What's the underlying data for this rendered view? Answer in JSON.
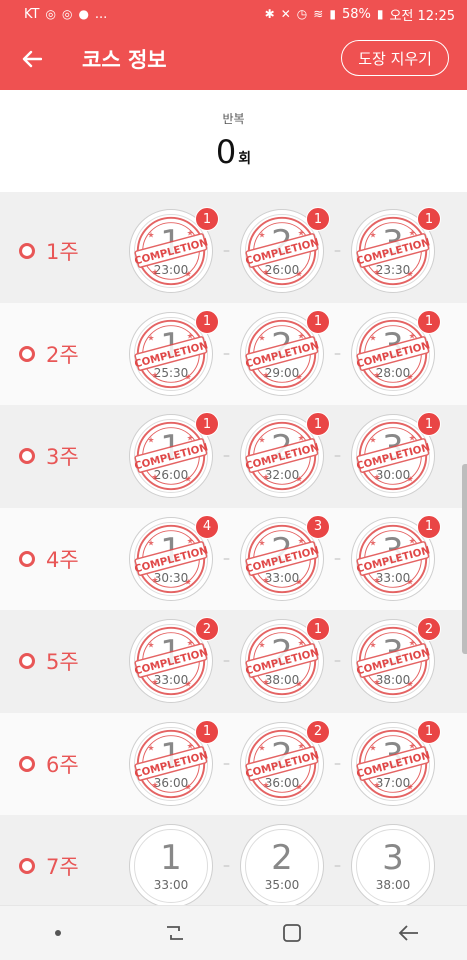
{
  "status_bar": {
    "carrier": "KT",
    "left_icons": [
      "instagram-icon",
      "instagram-icon",
      "talk-icon"
    ],
    "more": "...",
    "battery": "58%",
    "time_label": "오전 12:25"
  },
  "app_bar": {
    "title": "코스 정보",
    "clear_button": "도장 지우기"
  },
  "repeat": {
    "label": "반복",
    "value": "0",
    "unit": "회"
  },
  "weeks": [
    {
      "label": "1주",
      "sessions": [
        {
          "num": "1",
          "time": "23:00",
          "count": "1",
          "completed": true
        },
        {
          "num": "2",
          "time": "26:00",
          "count": "1",
          "completed": true
        },
        {
          "num": "3",
          "time": "23:30",
          "count": "1",
          "completed": true
        }
      ]
    },
    {
      "label": "2주",
      "sessions": [
        {
          "num": "1",
          "time": "25:30",
          "count": "1",
          "completed": true
        },
        {
          "num": "2",
          "time": "29:00",
          "count": "1",
          "completed": true
        },
        {
          "num": "3",
          "time": "28:00",
          "count": "1",
          "completed": true
        }
      ]
    },
    {
      "label": "3주",
      "sessions": [
        {
          "num": "1",
          "time": "26:00",
          "count": "1",
          "completed": true
        },
        {
          "num": "2",
          "time": "32:00",
          "count": "1",
          "completed": true
        },
        {
          "num": "3",
          "time": "30:00",
          "count": "1",
          "completed": true
        }
      ]
    },
    {
      "label": "4주",
      "sessions": [
        {
          "num": "1",
          "time": "30:30",
          "count": "4",
          "completed": true
        },
        {
          "num": "2",
          "time": "33:00",
          "count": "3",
          "completed": true
        },
        {
          "num": "3",
          "time": "33:00",
          "count": "1",
          "completed": true
        }
      ]
    },
    {
      "label": "5주",
      "sessions": [
        {
          "num": "1",
          "time": "33:00",
          "count": "2",
          "completed": true
        },
        {
          "num": "2",
          "time": "38:00",
          "count": "1",
          "completed": true
        },
        {
          "num": "3",
          "time": "38:00",
          "count": "2",
          "completed": true
        }
      ]
    },
    {
      "label": "6주",
      "sessions": [
        {
          "num": "1",
          "time": "36:00",
          "count": "1",
          "completed": true
        },
        {
          "num": "2",
          "time": "36:00",
          "count": "2",
          "completed": true
        },
        {
          "num": "3",
          "time": "37:00",
          "count": "1",
          "completed": true
        }
      ]
    },
    {
      "label": "7주",
      "sessions": [
        {
          "num": "1",
          "time": "33:00",
          "count": "",
          "completed": false
        },
        {
          "num": "2",
          "time": "35:00",
          "count": "",
          "completed": false
        },
        {
          "num": "3",
          "time": "38:00",
          "count": "",
          "completed": false
        }
      ]
    }
  ],
  "stamp_text": "COMPLETION",
  "colors": {
    "accent": "#ef5151",
    "stamp": "#e04848",
    "badge": "#e94545"
  }
}
